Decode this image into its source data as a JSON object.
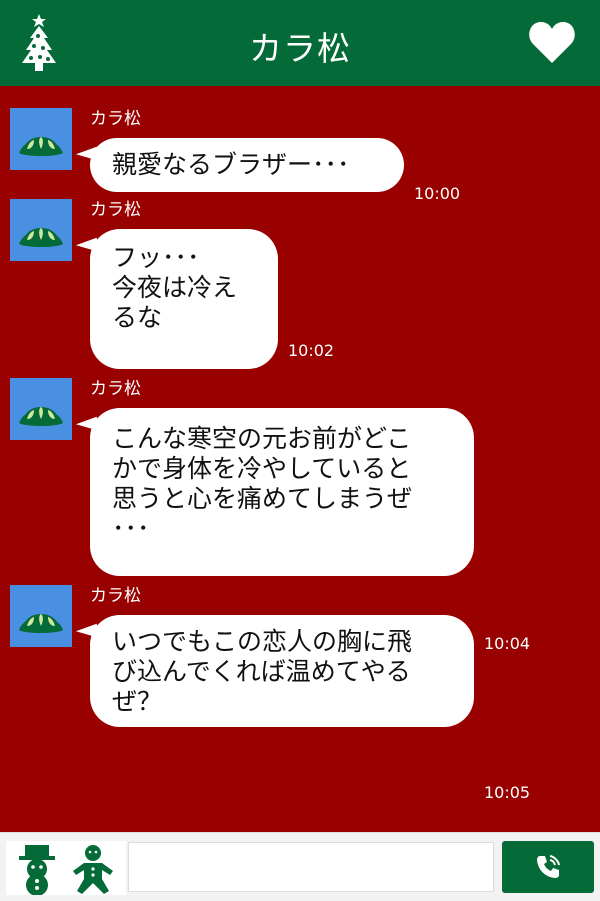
{
  "header": {
    "title": "カラ松",
    "left_icon": "christmas-tree-icon",
    "right_icon": "heart-icon"
  },
  "messages": [
    {
      "sender": "カラ松",
      "text": "親愛なるブラザー･･･",
      "time": "10:00"
    },
    {
      "sender": "カラ松",
      "text": "フッ･･･\n今夜は冷え\nるな",
      "time": "10:02"
    },
    {
      "sender": "カラ松",
      "text": "こんな寒空の元お前がどこ\nかで身体を冷やしていると\n思うと心を痛めてしまうぜ\n･･･",
      "time": "10:04"
    },
    {
      "sender": "カラ松",
      "text": "いつでもこの恋人の胸に飛\nび込んでくれば温めてやる\nぜ？",
      "time": "10:05"
    }
  ],
  "footer": {
    "stickers": [
      "snowman-icon",
      "gingerbread-man-icon"
    ],
    "input_value": "",
    "call_icon": "phone-icon"
  },
  "colors": {
    "header_bg": "#046b38",
    "chat_bg": "#990000",
    "avatar_bg": "#4a90e2",
    "bubble_bg": "#ffffff"
  }
}
